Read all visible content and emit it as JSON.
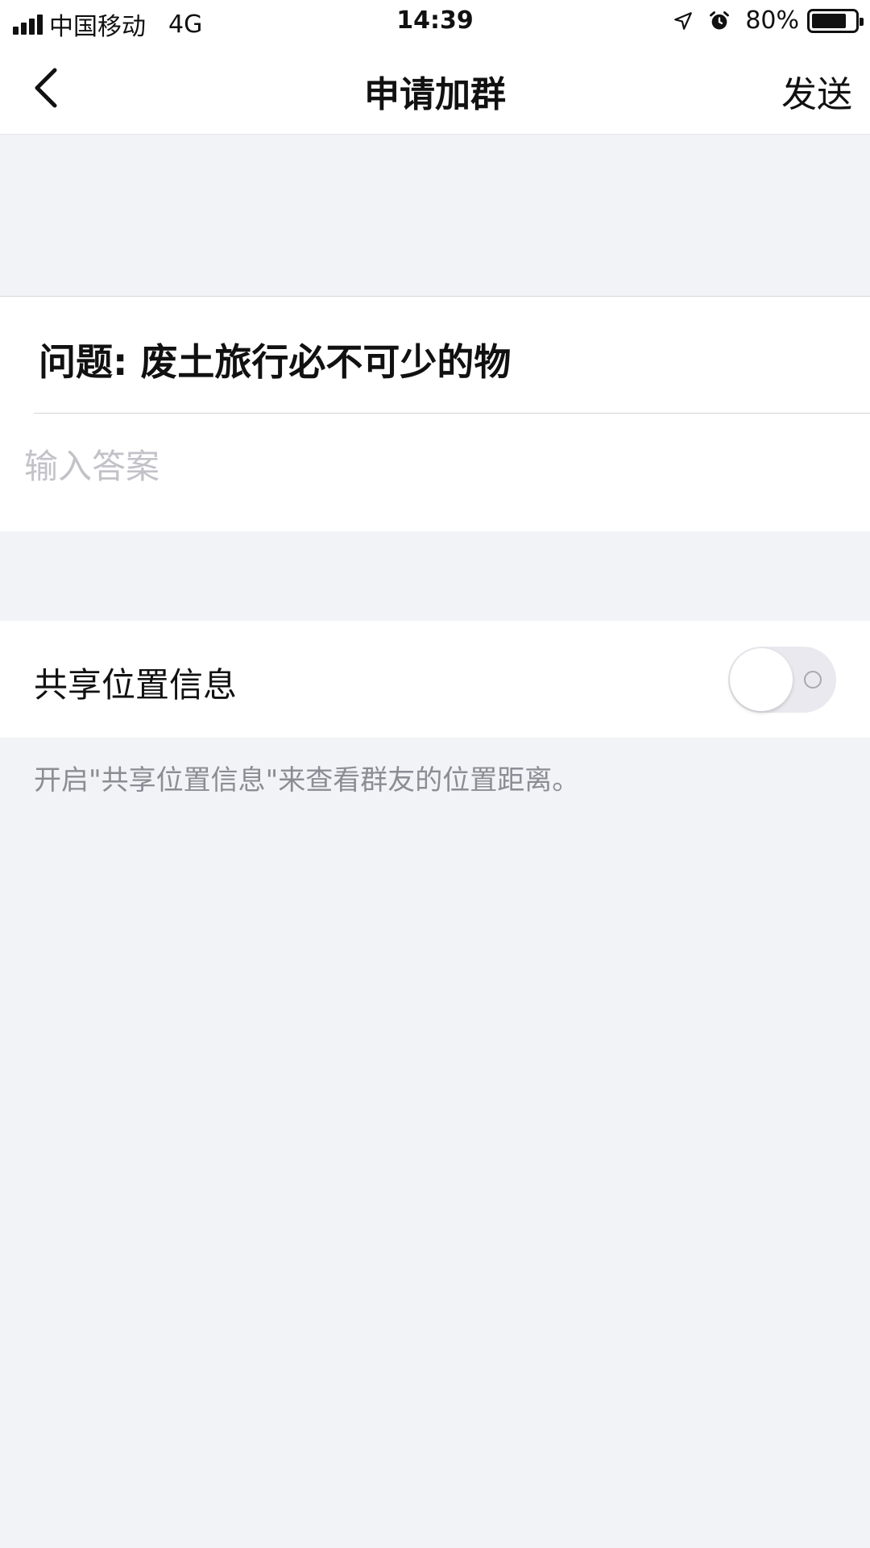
{
  "status_bar": {
    "carrier": "中国移动",
    "network": "4G",
    "time": "14:39",
    "battery": "80%",
    "battery_level": 0.8,
    "icons": [
      "signal-icon",
      "location-arrow-icon",
      "alarm-icon",
      "battery-icon"
    ]
  },
  "nav": {
    "back_icon": "chevron-left-icon",
    "title": "申请加群",
    "send_label": "发送"
  },
  "question": {
    "text": "问题: 废土旅行必不可少的物",
    "answer_value": "",
    "answer_placeholder": "输入答案"
  },
  "location": {
    "label": "共享位置信息",
    "toggle_on": false,
    "hint": "开启\"共享位置信息\"来查看群友的位置距离。"
  },
  "colors": {
    "background": "#f2f3f7",
    "card": "#ffffff",
    "placeholder": "#c2c2c8",
    "hint": "#8c8c94",
    "toggle_track": "#e9e9ef"
  }
}
